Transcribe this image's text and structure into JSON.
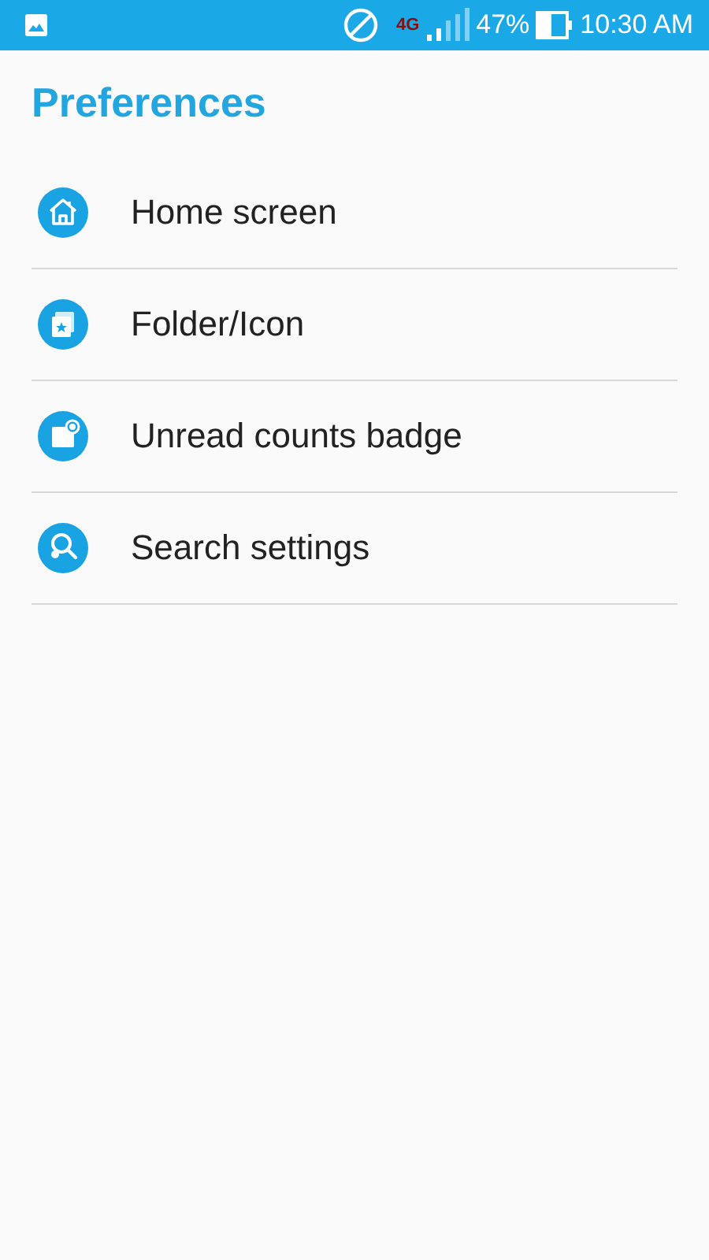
{
  "status_bar": {
    "network": "4G",
    "battery": "47%",
    "time": "10:30 AM"
  },
  "title": "Preferences",
  "items": [
    {
      "kind": "home",
      "label": "Home screen"
    },
    {
      "kind": "folder",
      "label": "Folder/Icon"
    },
    {
      "kind": "badge",
      "label": "Unread counts badge"
    },
    {
      "kind": "search",
      "label": "Search settings"
    }
  ]
}
